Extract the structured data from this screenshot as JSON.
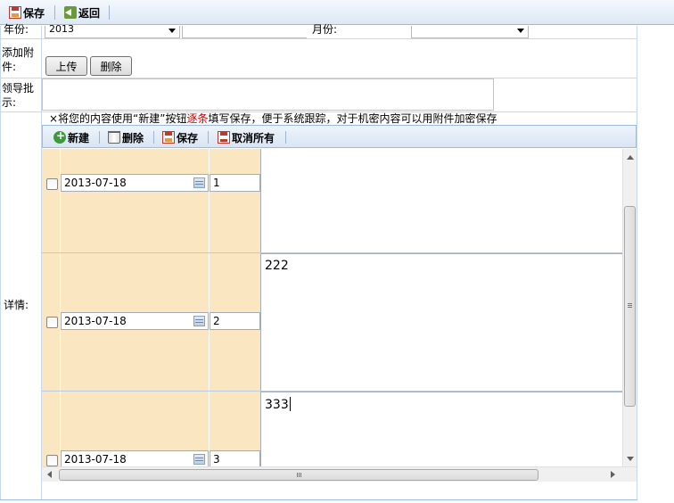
{
  "toolbar": {
    "save_label": "保存",
    "back_label": "返回",
    "save_icon": "save-icon",
    "back_icon": "back-icon"
  },
  "form": {
    "year_label": "年份:",
    "year_value": "2013",
    "month_label": "月份:",
    "month_value": "",
    "attachment_label": "添加附件:",
    "upload_button": "上传",
    "delete_button": "删除",
    "leader_label": "领导批示:",
    "leader_value": "",
    "details_label": "详情:"
  },
  "hint": {
    "prefix": "×将您的内容使用“新建”按钮",
    "highlight": "逐条",
    "suffix": "填写保存，便于系统跟踪，对于机密内容可以用附件加密保存",
    "highlight_color": "#cc0000"
  },
  "grid_toolbar": {
    "new_label": "新建",
    "delete_label": "删除",
    "save_label": "保存",
    "cancel_all_label": "取消所有"
  },
  "grid": {
    "rows": [
      {
        "date": "2013-07-18",
        "seq": "1",
        "content": ""
      },
      {
        "date": "2013-07-18",
        "seq": "2",
        "content": "222"
      },
      {
        "date": "2013-07-18",
        "seq": "3",
        "content": "333"
      }
    ]
  },
  "colors": {
    "toolbar_bg": "#dde8f5",
    "row_cell_bg": "#fbe6c2",
    "border": "#99bbe8"
  }
}
